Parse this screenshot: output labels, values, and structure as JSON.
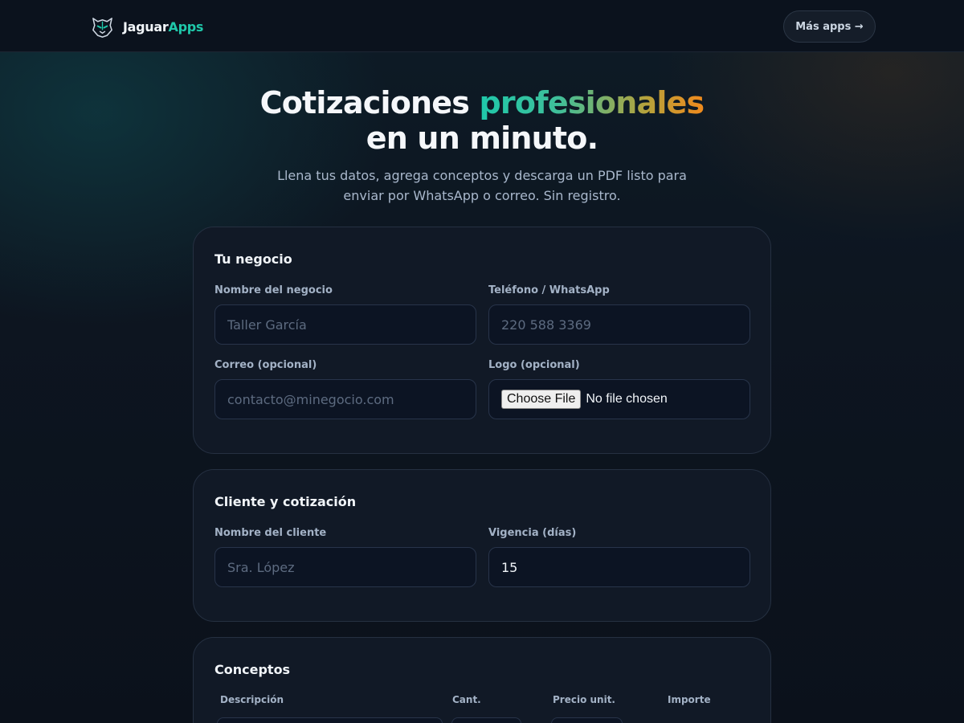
{
  "header": {
    "brand_main": "Jaguar",
    "brand_accent": "Apps",
    "more_apps_label": "Más apps →"
  },
  "hero": {
    "title_part1": "Cotizaciones ",
    "title_highlight": "profesionales",
    "title_line2": "en un minuto.",
    "subtitle": "Llena tus datos, agrega conceptos y descarga un PDF listo para enviar por WhatsApp o correo. Sin registro."
  },
  "business": {
    "title": "Tu negocio",
    "name_label": "Nombre del negocio",
    "name_placeholder": "Taller García",
    "phone_label": "Teléfono / WhatsApp",
    "phone_placeholder": "220 588 3369",
    "email_label": "Correo (opcional)",
    "email_placeholder": "contacto@minegocio.com",
    "logo_label": "Logo (opcional)",
    "logo_button": "Choose File",
    "logo_status": "No file chosen"
  },
  "client": {
    "title": "Cliente y cotización",
    "name_label": "Nombre del cliente",
    "name_placeholder": "Sra. López",
    "validity_label": "Vigencia (días)",
    "validity_value": "15"
  },
  "concepts": {
    "title": "Conceptos",
    "columns": [
      "Descripción",
      "Cant.",
      "Precio unit.",
      "Importe"
    ]
  },
  "colors": {
    "accent": "#1fc8aa",
    "accent_orange": "#f08a1d",
    "background": "#0c1320",
    "card": "#111926"
  }
}
